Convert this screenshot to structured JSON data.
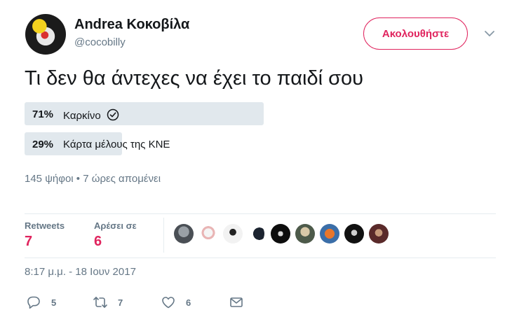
{
  "author": {
    "name": "Andrea Κοκοβίλα",
    "handle": "@cocobilly",
    "follow_label": "Ακολουθήστε"
  },
  "tweet": {
    "text": "Τι δεν θα άντεχες να έχει το παιδί σου"
  },
  "poll": {
    "options": [
      {
        "pct": "71%",
        "label": "Καρκίνο",
        "share": 0.71,
        "winner": true
      },
      {
        "pct": "29%",
        "label": "Κάρτα μέλους της ΚΝΕ",
        "share": 0.29,
        "winner": false
      }
    ],
    "meta": "145 ψήφοι • 7 ώρες απομένει"
  },
  "stats": {
    "retweets_label": "Retweets",
    "retweets_value": "7",
    "likes_label": "Αρέσει σε",
    "likes_value": "6"
  },
  "timestamp": "8:17 μ.μ. - 18 Ιουν 2017",
  "actions": {
    "reply_count": "5",
    "retweet_count": "7",
    "like_count": "6"
  },
  "colors": {
    "accent": "#e0245e",
    "muted": "#657786",
    "poll_bar": "#e1e8ed"
  }
}
